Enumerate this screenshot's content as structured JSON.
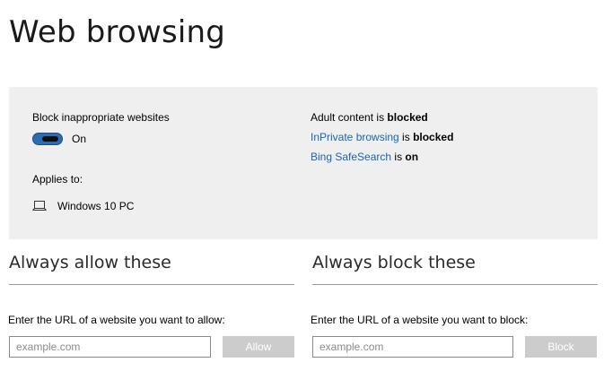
{
  "page": {
    "title": "Web browsing"
  },
  "summary": {
    "block_label": "Block inappropriate websites",
    "toggle_state": "On",
    "toggle_on": true,
    "applies_label": "Applies to:",
    "device_icon": "laptop-icon",
    "device_name": "Windows 10 PC",
    "status": [
      {
        "subject": "Adult content",
        "subject_is_link": false,
        "verb": " is ",
        "state": "blocked"
      },
      {
        "subject": "InPrivate browsing",
        "subject_is_link": true,
        "verb": " is ",
        "state": "blocked"
      },
      {
        "subject": "Bing SafeSearch",
        "subject_is_link": true,
        "verb": " is ",
        "state": "on"
      }
    ]
  },
  "allow": {
    "title": "Always allow these",
    "instruction": "Enter the URL of a website you want to allow:",
    "placeholder": "example.com",
    "button_label": "Allow",
    "button_enabled": false
  },
  "block": {
    "title": "Always block these",
    "instruction": "Enter the URL of a website you want to block:",
    "placeholder": "example.com",
    "button_label": "Block",
    "button_enabled": false
  },
  "colors": {
    "accent": "#2b6cb3",
    "link": "#1a64b6",
    "panel_bg": "#efefef",
    "disabled_button": "#cccccc"
  }
}
